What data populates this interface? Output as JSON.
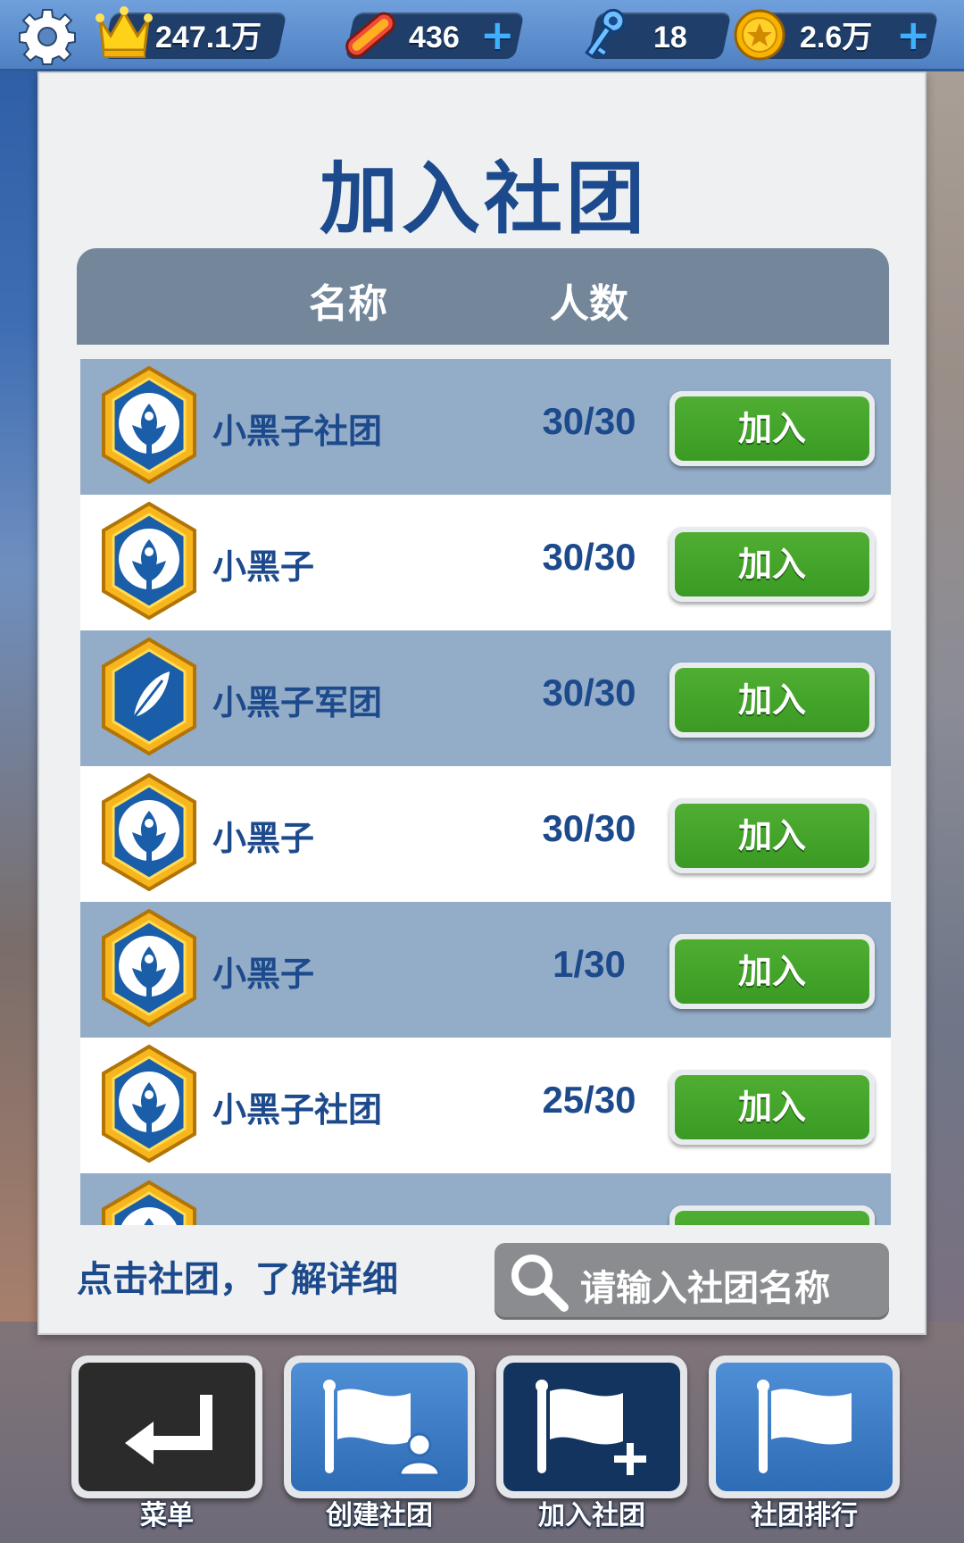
{
  "top_bar": {
    "crowns": "247.1万",
    "boards": "436",
    "keys": "18",
    "coins": "2.6万",
    "icons": [
      "gear-icon",
      "crown-icon",
      "hoverboard-icon",
      "key-icon",
      "coin-icon",
      "plus-icon"
    ]
  },
  "panel": {
    "title": "加入社团",
    "col_name": "名称",
    "col_count": "人数",
    "hint": "点击社团，了解详细",
    "search_placeholder": "请输入社团名称"
  },
  "clubs": [
    {
      "name": "小黑子社团",
      "count": "30/30",
      "join": "加入",
      "badge": "phoenix"
    },
    {
      "name": "小黑子",
      "count": "30/30",
      "join": "加入",
      "badge": "phoenix"
    },
    {
      "name": "小黑子军团",
      "count": "30/30",
      "join": "加入",
      "badge": "feather"
    },
    {
      "name": "小黑子",
      "count": "30/30",
      "join": "加入",
      "badge": "phoenix"
    },
    {
      "name": "小黑子",
      "count": "1/30",
      "join": "加入",
      "badge": "phoenix"
    },
    {
      "name": "小黑子社团",
      "count": "25/30",
      "join": "加入",
      "badge": "phoenix"
    }
  ],
  "nav": [
    {
      "label": "菜单",
      "icon": "return-icon"
    },
    {
      "label": "创建社团",
      "icon": "flag-person-icon"
    },
    {
      "label": "加入社团",
      "icon": "flag-plus-icon"
    },
    {
      "label": "社团排行",
      "icon": "flag-icon"
    }
  ],
  "colors": {
    "title_blue": "#1d4a8c",
    "row_alt": "#93acc7",
    "join_green": "#3f9f27",
    "header_gray": "#74869a"
  }
}
